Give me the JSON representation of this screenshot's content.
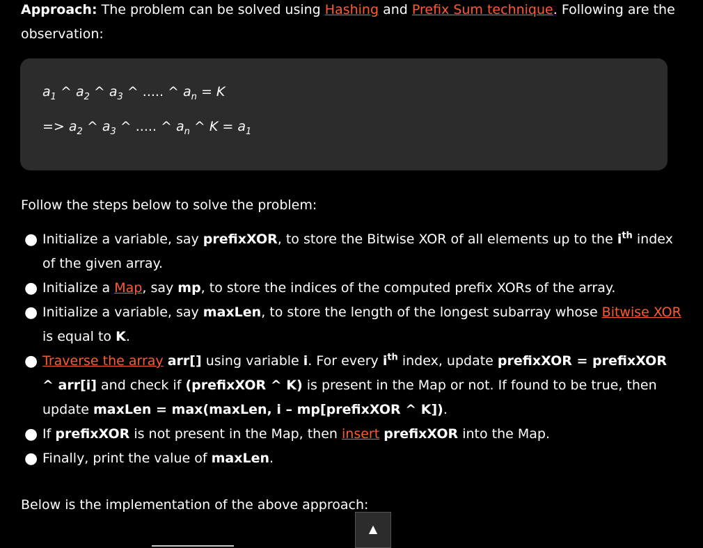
{
  "approach": {
    "lead": "Approach:",
    "t1": " The problem can be solved using ",
    "link_hashing": "Hashing",
    "t2": " and ",
    "link_prefix_sum": "Prefix Sum technique",
    "t3": ". Following are the observation:"
  },
  "math": {
    "line1": {
      "a": "a",
      "s1": "1",
      "x1": " ^ ",
      "b": "a",
      "s2": "2",
      "x2": " ^ ",
      "c": "a",
      "s3": "3",
      "dots": " ^ ..... ^ ",
      "d": "a",
      "sn": "n",
      "eq": " = ",
      "k": "K"
    },
    "line2": {
      "pre": "=> ",
      "a": "a",
      "s2": "2",
      "x1": " ^ ",
      "b": "a",
      "s3": "3",
      "dots": " ^ ..... ^ ",
      "c": "a",
      "sn": "n",
      "x2": " ^ ",
      "k": "K",
      "eq": " = ",
      "d": "a",
      "s1": "1"
    }
  },
  "follow_text": "Follow the steps below to solve the problem:",
  "steps": {
    "s1": {
      "t1": "Initialize a variable, say ",
      "b1": "prefixXOR",
      "t2": ", to store the Bitwise XOR of all elements up to the ",
      "b2": "i",
      "sup": "th",
      "t3": " index of the given array."
    },
    "s2": {
      "t1": "Initialize a ",
      "link": "Map",
      "t2": ", say ",
      "b1": "mp",
      "t3": ", to store the indices of the computed prefix XORs of the array."
    },
    "s3": {
      "t1": "Initialize a variable, say ",
      "b1": "maxLen",
      "t2": ", to store the length of the longest subarray whose ",
      "link": "Bitwise XOR",
      "t3": " is equal to ",
      "b2": "K",
      "t4": "."
    },
    "s4": {
      "link": "Traverse the array",
      "t1": " ",
      "b1": "arr[]",
      "t2": " using variable ",
      "b2": "i",
      "t3": ". For every ",
      "b3": "i",
      "sup": "th",
      "t4": " index, update ",
      "b4": "prefixXOR = prefixXOR ^ arr[i]",
      "t5": " and check if ",
      "b5": "(prefixXOR ^ K)",
      "t6": " is present in the Map or not. If found to be true, then update ",
      "b6": "maxLen = max(maxLen, i – mp[prefixXOR ^ K])",
      "t7": "."
    },
    "s5": {
      "t1": "If ",
      "b1": "prefixXOR",
      "t2": " is not present in the Map, then ",
      "link": "insert",
      "t3": " ",
      "b2": "prefixXOR",
      "t4": " into the Map."
    },
    "s6": {
      "t1": "Finally, print the value of ",
      "b1": "maxLen",
      "t2": "."
    }
  },
  "below_text": "Below is the implementation of the above approach:",
  "bullet": "●",
  "scroll_top_glyph": "▲"
}
